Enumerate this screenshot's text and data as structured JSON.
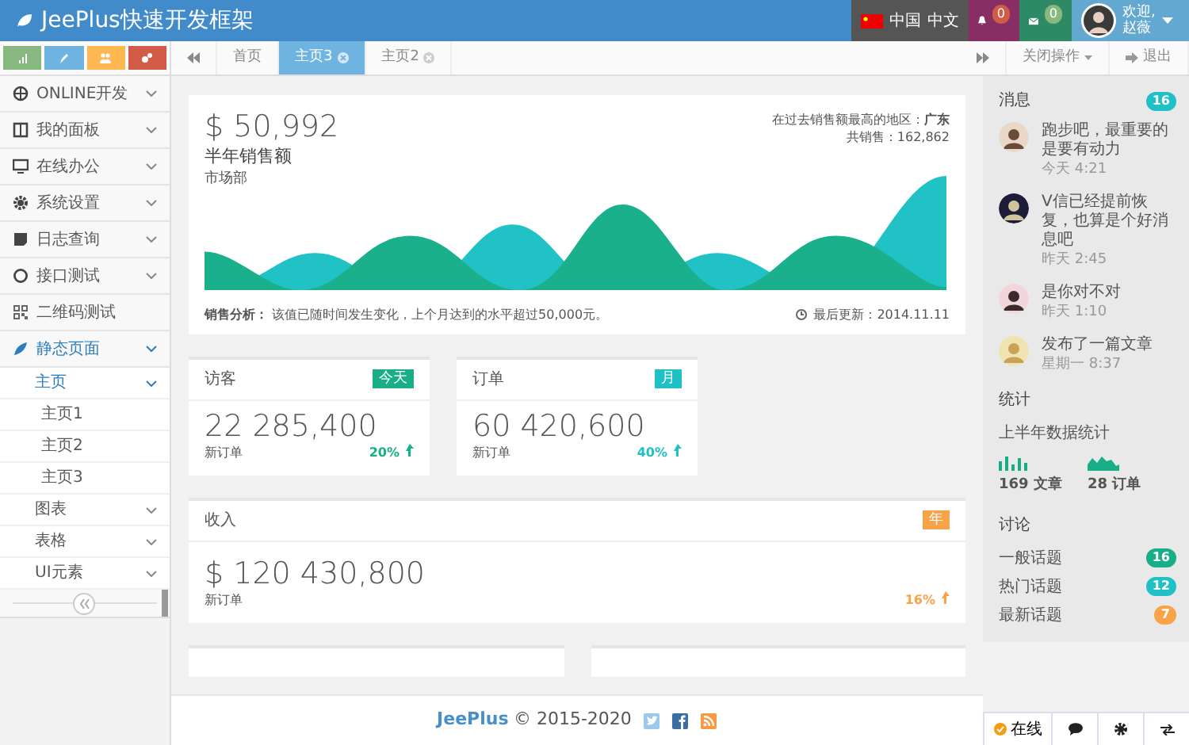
{
  "header": {
    "logo": "JeePlus快速开发框架",
    "language": {
      "country": "中国",
      "lang": "中文"
    },
    "notifications": "0",
    "messages": "0",
    "user": {
      "greeting": "欢迎,",
      "name": "赵薇"
    }
  },
  "shortcuts": [
    {
      "color": "#87b87f"
    },
    {
      "color": "#6fb3e0"
    },
    {
      "color": "#ffb752"
    },
    {
      "color": "#d15b47"
    }
  ],
  "tabs": [
    {
      "label": "首页",
      "selected": false,
      "closable": false
    },
    {
      "label": "主页3",
      "selected": true,
      "closable": true
    },
    {
      "label": "主页2",
      "selected": false,
      "closable": true
    }
  ],
  "tab_tools": {
    "close_ops": "关闭操作",
    "logout": "退出"
  },
  "sidebar": {
    "items": [
      {
        "label": "ONLINE开发",
        "submenu": true,
        "selected": false
      },
      {
        "label": "我的面板",
        "submenu": true,
        "selected": false
      },
      {
        "label": "在线办公",
        "submenu": true,
        "selected": false
      },
      {
        "label": "系统设置",
        "submenu": true,
        "selected": false
      },
      {
        "label": "日志查询",
        "submenu": true,
        "selected": false
      },
      {
        "label": "接口测试",
        "submenu": true,
        "selected": false
      },
      {
        "label": "二维码测试",
        "submenu": false,
        "selected": false
      },
      {
        "label": "静态页面",
        "submenu": true,
        "selected": true,
        "children": [
          {
            "label": "主页",
            "submenu": true,
            "selected": true,
            "children": [
              {
                "label": "主页1",
                "submenu": false,
                "selected": false
              },
              {
                "label": "主页2",
                "submenu": false,
                "selected": false
              },
              {
                "label": "主页3",
                "submenu": false,
                "selected": false
              }
            ]
          },
          {
            "label": "图表",
            "submenu": true,
            "selected": false
          },
          {
            "label": "表格",
            "submenu": true,
            "selected": false
          },
          {
            "label": "UI元素",
            "submenu": true,
            "selected": false
          }
        ]
      }
    ]
  },
  "sales": {
    "amount": "$ 50,992",
    "title": "半年销售额",
    "dept": "市场部",
    "region": "在过去销售额最高的地区：**广东**",
    "total": "共销售：162,862",
    "analysis": "**销售分析：** 该值已随时间发生变化，上个月达到的水平超过50,000元。",
    "updated": "最后更新：2014.11.11"
  },
  "stat_cards": [
    {
      "title": "访客",
      "tag": "今天",
      "color": "#1aae88",
      "value": "22 285,400",
      "sub": "新订单",
      "change": "20%"
    },
    {
      "title": "订单",
      "tag": "月",
      "color": "#1fc1c6",
      "value": "60 420,600",
      "sub": "新订单",
      "change": "40%"
    }
  ],
  "income_card": {
    "title": "收入",
    "tag": "年",
    "color": "#f8a348",
    "value": "$ 120 430,800",
    "sub": "新订单",
    "change": "16%"
  },
  "footer": {
    "brand": "JeePlus",
    "text": "© 2015-2020"
  },
  "right_panel": {
    "messages": {
      "title": "消息",
      "count": "16",
      "items": [
        {
          "text": "跑步吧，最重要的是要有动力",
          "time": "今天 4:21"
        },
        {
          "text": "V信已经提前恢复，也算是个好消息吧",
          "time": "昨天 2:45"
        },
        {
          "text": "是你对不对",
          "time": "昨天 1:10"
        },
        {
          "text": "发布了一篇文章",
          "time": "星期一 8:37"
        }
      ]
    },
    "stats": {
      "title": "统计",
      "subtitle": "上半年数据统计",
      "items": [
        {
          "kind": "bars",
          "label": "169 文章"
        },
        {
          "kind": "area",
          "label": "28 订单"
        }
      ]
    },
    "discussion": {
      "title": "讨论",
      "topics": [
        {
          "label": "一般话题",
          "count": "16",
          "color": "#1aae88"
        },
        {
          "label": "热门话题",
          "count": "12",
          "color": "#1fc1c6"
        },
        {
          "label": "最新话题",
          "count": "7",
          "color": "#f8a348"
        }
      ]
    },
    "status": "在线"
  }
}
